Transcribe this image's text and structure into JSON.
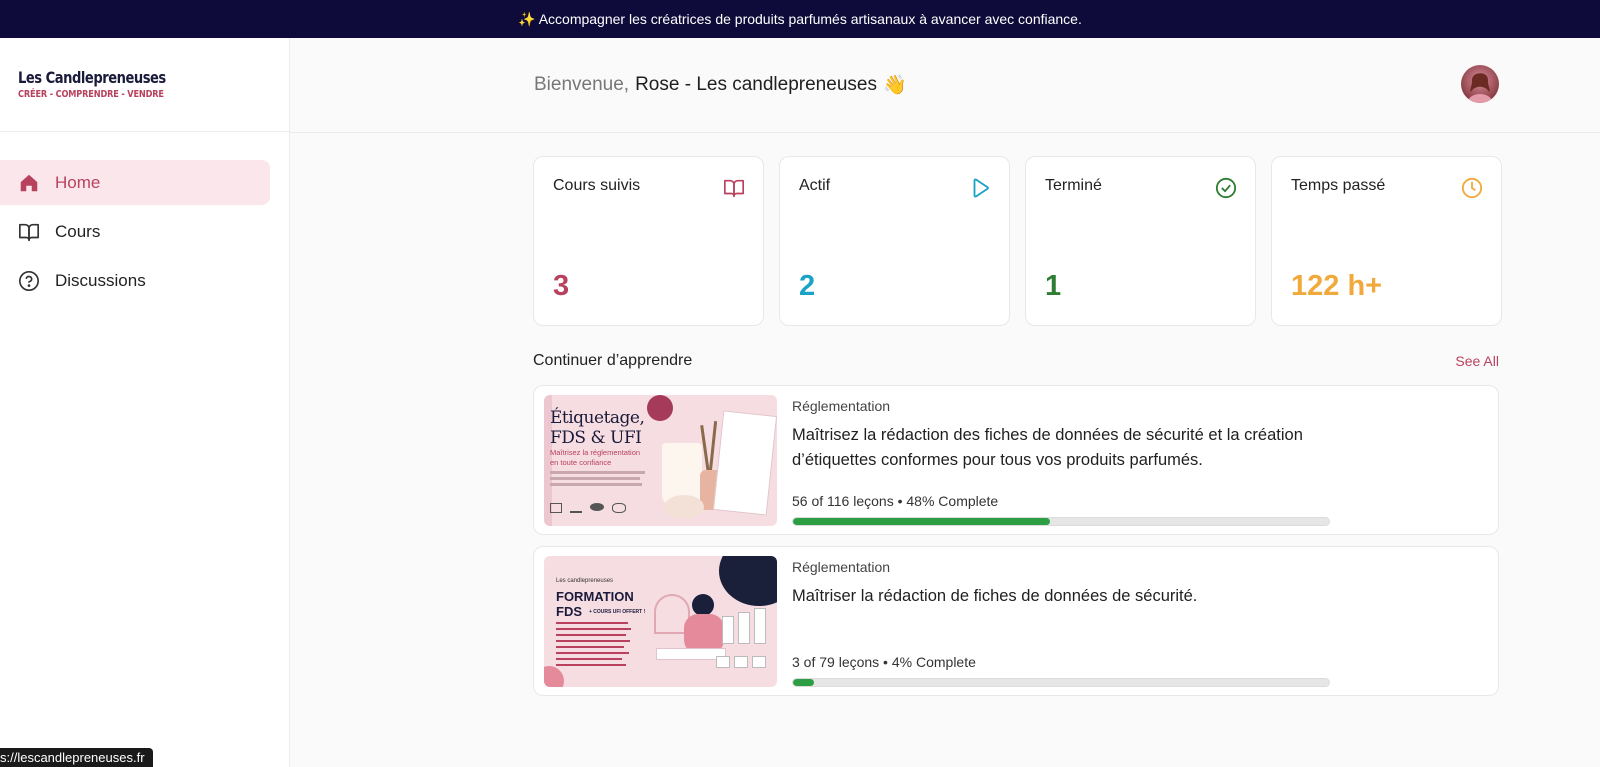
{
  "banner": {
    "text": "✨ Accompagner les créatrices de produits parfumés artisanaux à avancer avec confiance."
  },
  "brand": {
    "name": "Les Candlepreneuses",
    "tagline": "CRÉER - COMPRENDRE - VENDRE"
  },
  "sidebar": {
    "items": [
      {
        "label": "Home",
        "icon": "home-icon",
        "active": true
      },
      {
        "label": "Cours",
        "icon": "book-icon",
        "active": false
      },
      {
        "label": "Discussions",
        "icon": "help-circle-icon",
        "active": false
      }
    ]
  },
  "header": {
    "welcome_label": "Bienvenue,",
    "user_name": "Rose - Les candlepreneuses",
    "wave": "👋"
  },
  "stats": [
    {
      "label": "Cours suivis",
      "value": "3",
      "color": "#b8415e",
      "icon": "book-icon"
    },
    {
      "label": "Actif",
      "value": "2",
      "color": "#1ba3c6",
      "icon": "play-icon"
    },
    {
      "label": "Terminé",
      "value": "1",
      "color": "#2e7d32",
      "icon": "check-circle-icon"
    },
    {
      "label": "Temps passé",
      "value": "122 h+",
      "color": "#f2a93b",
      "icon": "clock-icon"
    }
  ],
  "continue": {
    "title": "Continuer d’apprendre",
    "see_all": "See All",
    "courses": [
      {
        "category": "Réglementation",
        "title": "Maîtrisez la rédaction des fiches de données de sécurité et la création d’étiquettes conformes pour tous vos produits parfumés.",
        "progress_text": "56 of 116 leçons • 48% Complete",
        "progress": 0.48,
        "thumb": {
          "heading1": "Étiquetage,",
          "heading2": "FDS & UFI",
          "subtitle": "Maîtrisez la réglementation en toute confiance"
        }
      },
      {
        "category": "Réglementation",
        "title": "Maîtriser la rédaction de fiches de données de sécurité.",
        "progress_text": "3 of 79 leçons • 4% Complete",
        "progress": 0.04,
        "thumb": {
          "brand": "Les candlepreneuses",
          "heading1": "FORMATION",
          "heading2": "FDS",
          "badge": "+ COURS UFI OFFERT !"
        }
      }
    ]
  },
  "status_url": "s://lescandlepreneuses.fr"
}
